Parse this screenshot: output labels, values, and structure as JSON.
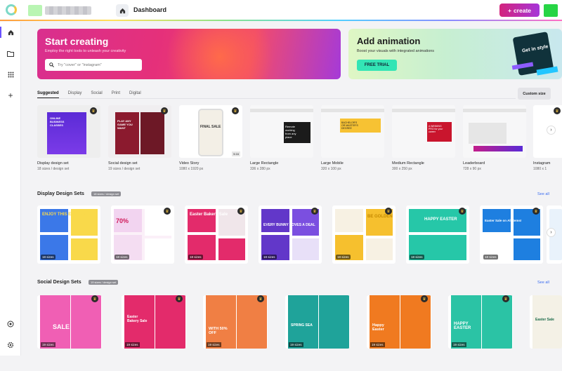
{
  "header": {
    "title": "Dashboard",
    "create_label": "create"
  },
  "hero": {
    "create": {
      "title": "Start creating",
      "subtitle": "Employ the right tools to unleash your creativity",
      "search_placeholder": "Try \"cover\" or \"instagram\""
    },
    "animation": {
      "title": "Add animation",
      "subtitle": "Boost your visuals with integrated animations",
      "cta": "FREE TRIAL",
      "art_text": "Get in style"
    }
  },
  "tabs": [
    "Suggested",
    "Display",
    "Social",
    "Print",
    "Digital"
  ],
  "custom_size": "Custom size",
  "templates": [
    {
      "name": "Display design set",
      "size": "18 sizes / design set",
      "t1": "ONLINE BUSINESS CLASSES"
    },
    {
      "name": "Social design set",
      "size": "19 sizes / design set",
      "t1": "PLAY ANY GAME YOU WANT"
    },
    {
      "name": "Video Story",
      "size": "1080 x 1920 px",
      "t1": "FINAL SALE",
      "badge": "5:16"
    },
    {
      "name": "Large Rectangle",
      "size": "336 x 280 px",
      "t1": "Remote working from any place"
    },
    {
      "name": "Large Mobile",
      "size": "320 x 100 px",
      "t1": "BACHELOR'S OR MASTER'S DEGREE"
    },
    {
      "name": "Medium Rectangle",
      "size": "300 x 250 px",
      "t1": "A WINNING PRO for your career"
    },
    {
      "name": "Leaderboard",
      "size": "728 x 90 px",
      "t1": ""
    },
    {
      "name": "Instagram",
      "size": "1080 x 1"
    }
  ],
  "display_sets": {
    "title": "Display Design Sets",
    "badge": "18 sizes / design set",
    "see_all": "See all",
    "cards": [
      {
        "label": "18 sizes",
        "t": "ENJOY THIS EASTER"
      },
      {
        "label": "18 sizes",
        "t": "70%"
      },
      {
        "label": "18 sizes",
        "t": "Easter Bakery Sale"
      },
      {
        "label": "18 sizes",
        "t": "EVERY BUNNY LOVES A DEAL"
      },
      {
        "label": "18 sizes",
        "t": "BE GOLDEN"
      },
      {
        "label": "18 sizes",
        "t": "HAPPY EASTER"
      },
      {
        "label": "18 sizes",
        "t": "Easter Sale on All Items!"
      }
    ]
  },
  "social_sets": {
    "title": "Social Design Sets",
    "badge": "19 sizes / design set",
    "see_all": "See all",
    "cards": [
      {
        "label": "19 sizes",
        "t": "SALE"
      },
      {
        "label": "19 sizes",
        "t": "Easter Bakery Sale"
      },
      {
        "label": "19 sizes",
        "t": "WITH 50% OFF"
      },
      {
        "label": "19 sizes",
        "t": "SPRING SEA"
      },
      {
        "label": "19 sizes",
        "t": "Happy Easter"
      },
      {
        "label": "19 sizes",
        "t": "HAPPY EASTER"
      },
      {
        "label": "19 sizes",
        "t": "Easter Sale"
      }
    ]
  },
  "colors": {
    "accent": "#6b52ff",
    "hero_pink": "#e5307a",
    "trial": "#33e5b5"
  }
}
